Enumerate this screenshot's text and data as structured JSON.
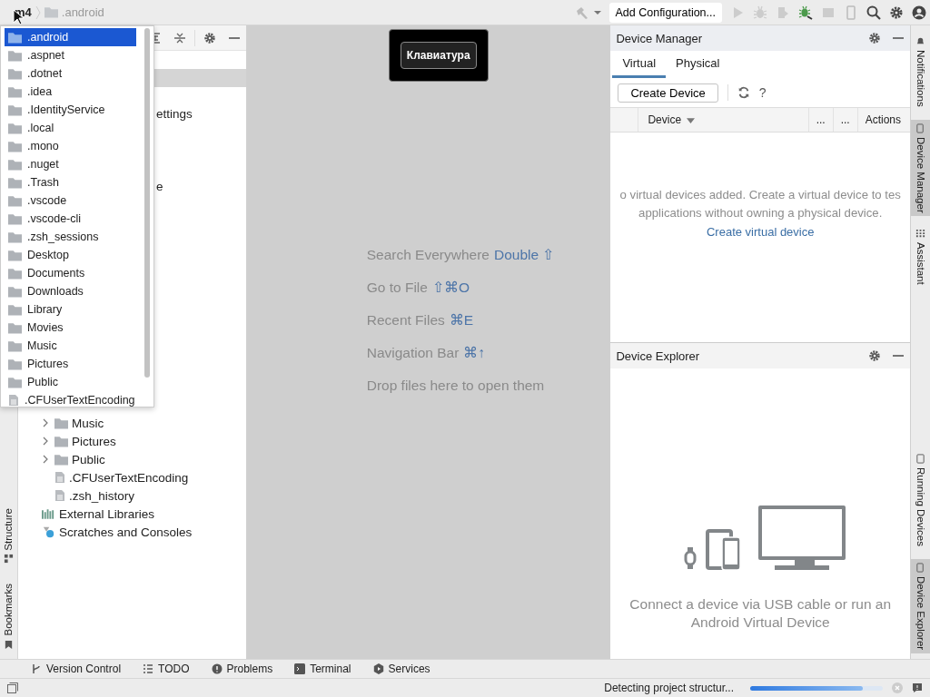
{
  "breadcrumb": [
    {
      "label": "m4",
      "kind": "project"
    },
    {
      "label": ".android",
      "kind": "folder"
    }
  ],
  "toolbar": {
    "run_config": "Add Configuration..."
  },
  "popup": {
    "items": [
      {
        "label": ".android",
        "kind": "folder",
        "selected": true
      },
      {
        "label": ".aspnet",
        "kind": "folder",
        "selected": false
      },
      {
        "label": ".dotnet",
        "kind": "folder",
        "selected": false
      },
      {
        "label": ".idea",
        "kind": "folder",
        "selected": false
      },
      {
        "label": ".IdentityService",
        "kind": "folder",
        "selected": false
      },
      {
        "label": ".local",
        "kind": "folder",
        "selected": false
      },
      {
        "label": ".mono",
        "kind": "folder",
        "selected": false
      },
      {
        "label": ".nuget",
        "kind": "folder",
        "selected": false
      },
      {
        "label": ".Trash",
        "kind": "folder",
        "selected": false
      },
      {
        "label": ".vscode",
        "kind": "folder",
        "selected": false
      },
      {
        "label": ".vscode-cli",
        "kind": "folder",
        "selected": false
      },
      {
        "label": ".zsh_sessions",
        "kind": "folder",
        "selected": false
      },
      {
        "label": "Desktop",
        "kind": "folder",
        "selected": false
      },
      {
        "label": "Documents",
        "kind": "folder",
        "selected": false
      },
      {
        "label": "Downloads",
        "kind": "folder",
        "selected": false
      },
      {
        "label": "Library",
        "kind": "folder",
        "selected": false
      },
      {
        "label": "Movies",
        "kind": "folder",
        "selected": false
      },
      {
        "label": "Music",
        "kind": "folder",
        "selected": false
      },
      {
        "label": "Pictures",
        "kind": "folder",
        "selected": false
      },
      {
        "label": "Public",
        "kind": "folder",
        "selected": false
      },
      {
        "label": ".CFUserTextEncoding",
        "kind": "file",
        "selected": false
      }
    ]
  },
  "project_tree": {
    "partial_labels": [
      "ettings",
      "e"
    ],
    "rows": [
      {
        "children": [
          {
            "label": "Music",
            "kind": "folder",
            "expanded": false
          },
          {
            "label": "Pictures",
            "kind": "folder",
            "expanded": false
          },
          {
            "label": "Public",
            "kind": "folder",
            "expanded": false
          },
          {
            "label": ".CFUserTextEncoding",
            "kind": "file"
          },
          {
            "label": ".zsh_history",
            "kind": "file"
          }
        ]
      },
      {
        "label": "External Libraries",
        "kind": "libraries"
      },
      {
        "label": "Scratches and Consoles",
        "kind": "scratches"
      }
    ]
  },
  "editor": {
    "hints": [
      {
        "text": "Search Everywhere",
        "shortcut": "Double ⇧"
      },
      {
        "text": "Go to File",
        "shortcut": "⇧⌘O"
      },
      {
        "text": "Recent Files",
        "shortcut": "⌘E"
      },
      {
        "text": "Navigation Bar",
        "shortcut": "⌘↑"
      },
      {
        "text": "Drop files here to open them"
      }
    ],
    "overlay": "Клавиатура"
  },
  "device_manager": {
    "title": "Device Manager",
    "tabs": [
      {
        "label": "Virtual",
        "selected": true
      },
      {
        "label": "Physical",
        "selected": false
      }
    ],
    "create_button": "Create Device",
    "help": "?",
    "columns": [
      "Device",
      "...",
      "...",
      "Actions"
    ],
    "empty_message": [
      "o virtual devices added. Create a virtual device to tes",
      "applications without owning a physical device."
    ],
    "link": "Create virtual device"
  },
  "device_explorer": {
    "title": "Device Explorer",
    "message": "Connect a device via USB cable or run an Android Virtual Device"
  },
  "left_stripe": [
    {
      "label": "Structure",
      "kind": "structure",
      "selected": false
    },
    {
      "label": "Bookmarks",
      "kind": "bookmarks",
      "selected": false
    }
  ],
  "right_stripe_top": [
    {
      "label": "Notifications",
      "kind": "bell",
      "selected": false
    },
    {
      "label": "Device Manager",
      "kind": "device",
      "selected": true
    },
    {
      "label": "Assistant",
      "kind": "assistant",
      "selected": false
    }
  ],
  "right_stripe_bottom": [
    {
      "label": "Running Devices",
      "kind": "running",
      "selected": false
    },
    {
      "label": "Device Explorer",
      "kind": "device",
      "selected": true
    }
  ],
  "bottom_tools": [
    {
      "label": "Version Control",
      "kind": "vcs"
    },
    {
      "label": "TODO",
      "kind": "todo"
    },
    {
      "label": "Problems",
      "kind": "problems"
    },
    {
      "label": "Terminal",
      "kind": "terminal"
    },
    {
      "label": "Services",
      "kind": "services"
    }
  ],
  "status": {
    "text": "Detecting project structur...",
    "level": 0.85
  }
}
